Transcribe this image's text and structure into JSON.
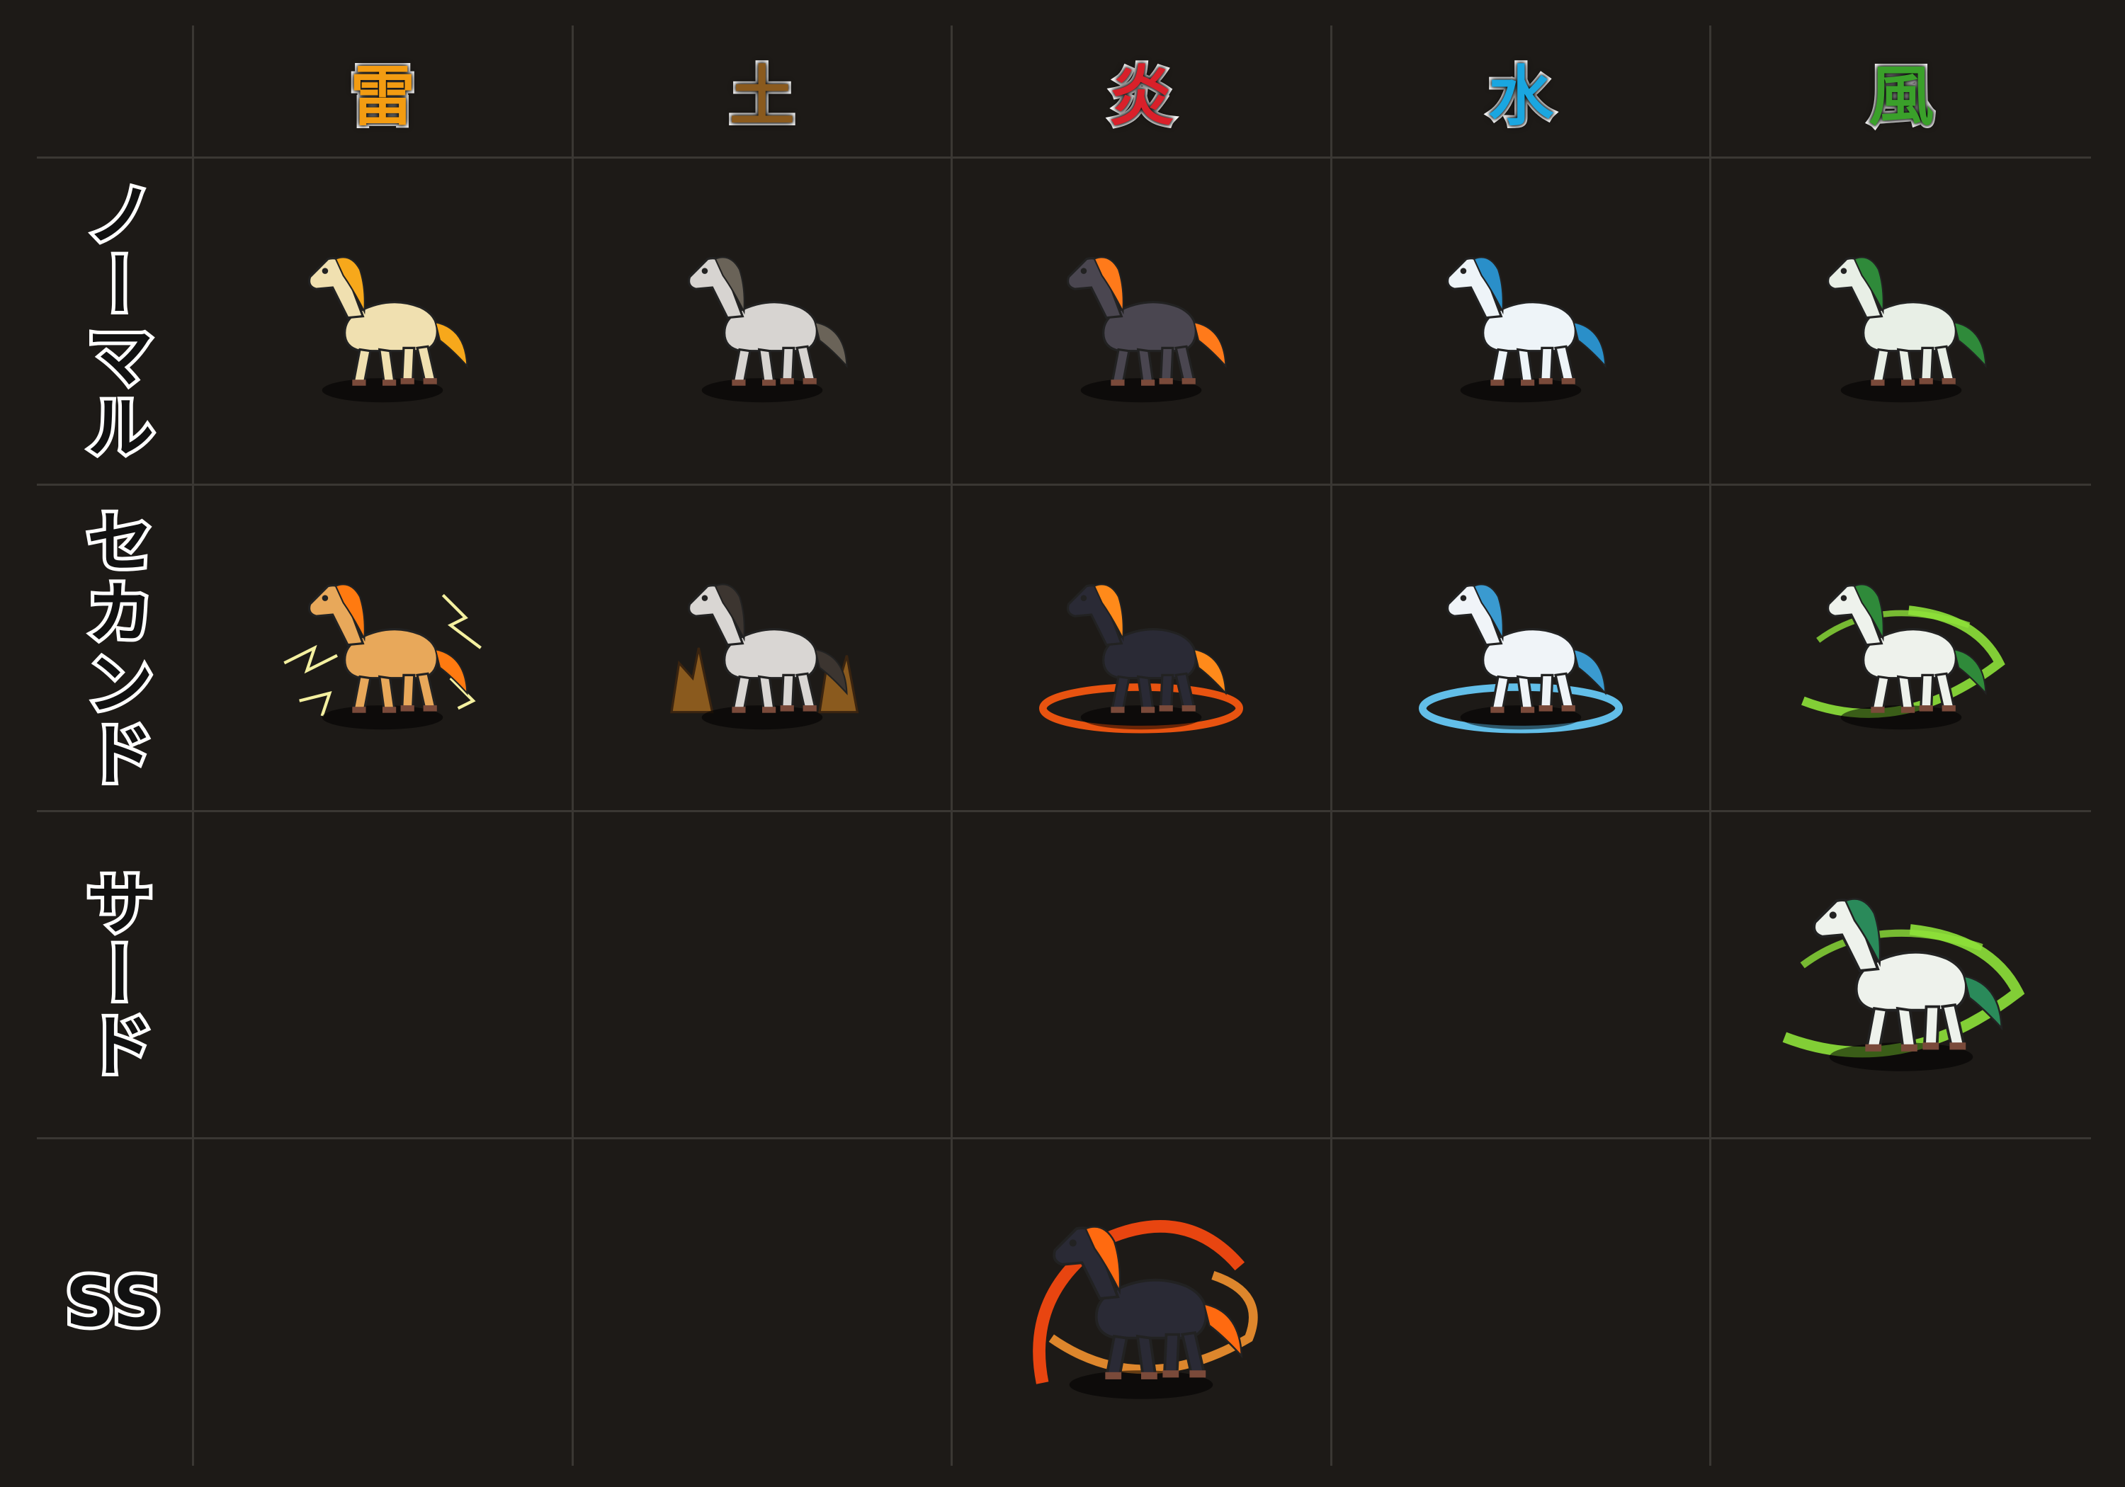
{
  "columns": [
    {
      "label": "雷",
      "color": "#f39c12"
    },
    {
      "label": "土",
      "color": "#8a5a1e"
    },
    {
      "label": "炎",
      "color": "#d9202a"
    },
    {
      "label": "水",
      "color": "#1aa6e0"
    },
    {
      "label": "風",
      "color": "#3aa02a"
    }
  ],
  "rows": [
    {
      "label": "ノーマル"
    },
    {
      "label": "セカンド"
    },
    {
      "label": "サード"
    },
    {
      "label": "SS"
    }
  ],
  "monsters": {
    "normal": [
      {
        "element": "雷",
        "icon": "thunder-horse-icon",
        "body": "#f0e0b0",
        "mane": "#f7a81b"
      },
      {
        "element": "土",
        "icon": "earth-horse-icon",
        "body": "#d7d4d1",
        "mane": "#6a6358"
      },
      {
        "element": "炎",
        "icon": "fire-horse-icon",
        "body": "#4a4650",
        "mane": "#ff7a1a"
      },
      {
        "element": "水",
        "icon": "water-horse-icon",
        "body": "#eef4f8",
        "mane": "#2a8fc9"
      },
      {
        "element": "風",
        "icon": "wind-horse-icon",
        "body": "#e8efe6",
        "mane": "#2f8a3a"
      }
    ],
    "second": [
      {
        "element": "雷",
        "icon": "thunder-horse-second-icon",
        "body": "#e8a85a",
        "mane": "#ff7a10",
        "fx": "#f4f0a0"
      },
      {
        "element": "土",
        "icon": "earth-horse-second-icon",
        "body": "#d9d6d3",
        "mane": "#3c3530",
        "fx": "#8a5a1e"
      },
      {
        "element": "炎",
        "icon": "fire-horse-second-icon",
        "body": "#2a2a35",
        "mane": "#ff8a1a",
        "fx": "#ff5a10"
      },
      {
        "element": "水",
        "icon": "water-horse-second-icon",
        "body": "#f0f4f8",
        "mane": "#3a9ad0",
        "fx": "#6ad0ff"
      },
      {
        "element": "風",
        "icon": "wind-horse-second-icon",
        "body": "#eef2ec",
        "mane": "#2f8a3a",
        "fx": "#8ee23a"
      }
    ],
    "third": [
      {
        "element": "風",
        "icon": "wind-horse-third-icon",
        "body": "#eef2ec",
        "mane": "#2a8a5a",
        "fx": "#8ee23a"
      }
    ],
    "ss": [
      {
        "element": "炎",
        "icon": "fire-horse-ss-icon",
        "body": "#2a2a35",
        "mane": "#ff6a10",
        "fx": "#ff4a10"
      }
    ]
  }
}
